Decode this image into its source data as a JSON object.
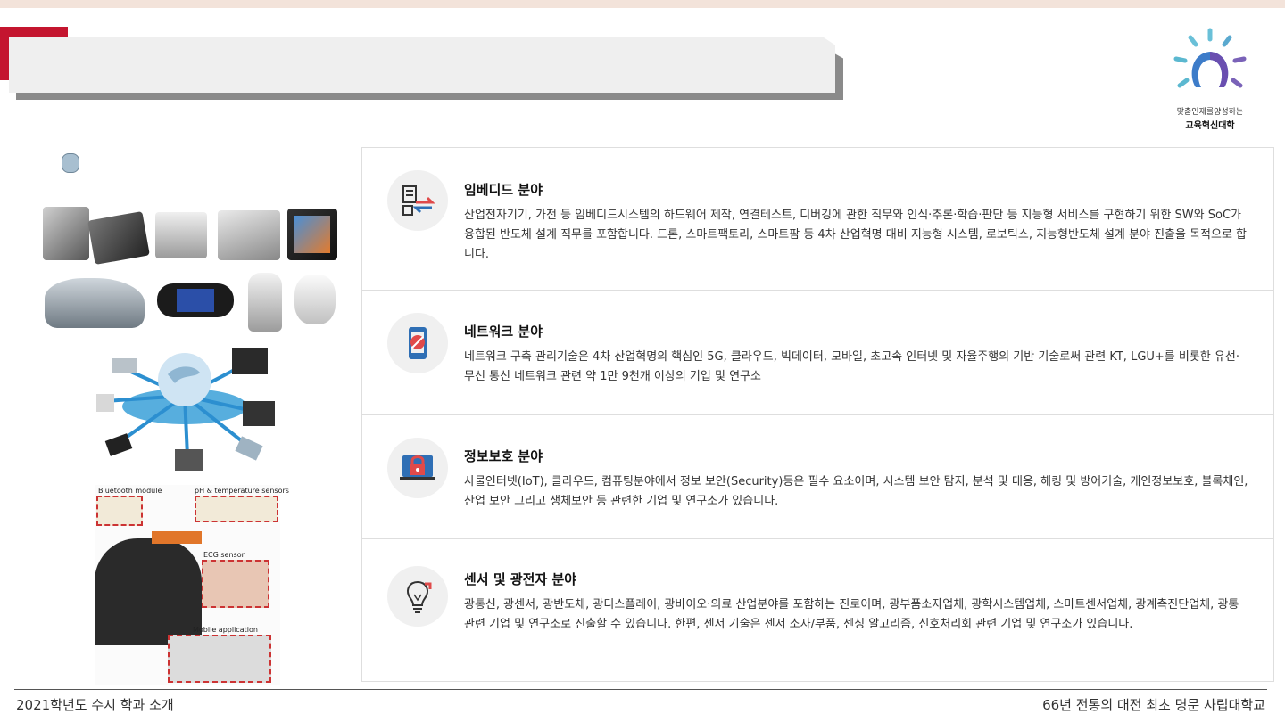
{
  "branding": {
    "logo_line1": "맞춤인재를양성하는",
    "logo_line2": "교육혁신대학"
  },
  "header": {
    "title": ""
  },
  "fields": [
    {
      "icon": "embedded-transfer-icon",
      "title": "임베디드 분야",
      "desc": "산업전자기기, 가전 등 임베디드시스템의 하드웨어 제작, 연결테스트, 디버깅에 관한 직무와 인식·추론·학습·판단 등 지능형 서비스를 구현하기 위한 SW와 SoC가 융합된 반도체 설계 직무를 포함합니다. 드론, 스마트팩토리, 스마트팜 등 4차 산업혁명 대비 지능형 시스템, 로보틱스, 지능형반도체 설계 분야 진출을 목적으로 합니다."
    },
    {
      "icon": "network-phone-icon",
      "title": "네트워크 분야",
      "desc": "네트워크 구축 관리기술은 4차 산업혁명의 핵심인 5G, 클라우드, 빅데이터, 모바일, 초고속 인터넷 및 자율주행의 기반 기술로써 관련 KT, LGU+를 비롯한 유선·무선 통신 네트워크 관련 약 1만 9천개 이상의 기업 및 연구소"
    },
    {
      "icon": "security-lock-icon",
      "title": "정보보호 분야",
      "desc": "사물인터넷(IoT), 클라우드, 컴퓨팅분야에서 정보 보안(Security)등은 필수 요소이며, 시스템 보안 탐지, 분석 및 대응, 해킹 및 방어기술, 개인정보보호, 블록체인, 산업 보안 그리고 생체보안 등 관련한 기업 및 연구소가 있습니다."
    },
    {
      "icon": "lightbulb-sensor-icon",
      "title": "센서 및 광전자 분야",
      "desc": "광통신, 광센서, 광반도체, 광디스플레이, 광바이오·의료 산업분야를 포함하는 진로이며, 광부품소자업체, 광학시스템업체, 스마트센서업체, 광계측진단업체, 광통관련 기업 및 연구소로 진출할 수 있습니다. 한편, 센서 기술은 센서 소자/부품, 센싱 알고리즘, 신호처리회 관련 기업 및 연구소가 있습니다."
    }
  ],
  "images": {
    "sensor_labels": [
      "Bluetooth module",
      "pH & temperature sensors",
      "ECG sensor",
      "Mobile application"
    ]
  },
  "footer": {
    "left": "2021학년도 수시 학과 소개",
    "right": "66년 전통의 대전 최초 명문 사립대학교"
  },
  "colors": {
    "accent_red": "#c4152f",
    "panel_border": "#dedede",
    "icon_bg": "#f0f0f0",
    "icon_red": "#e04a4a",
    "icon_blue": "#2f6fb5"
  }
}
